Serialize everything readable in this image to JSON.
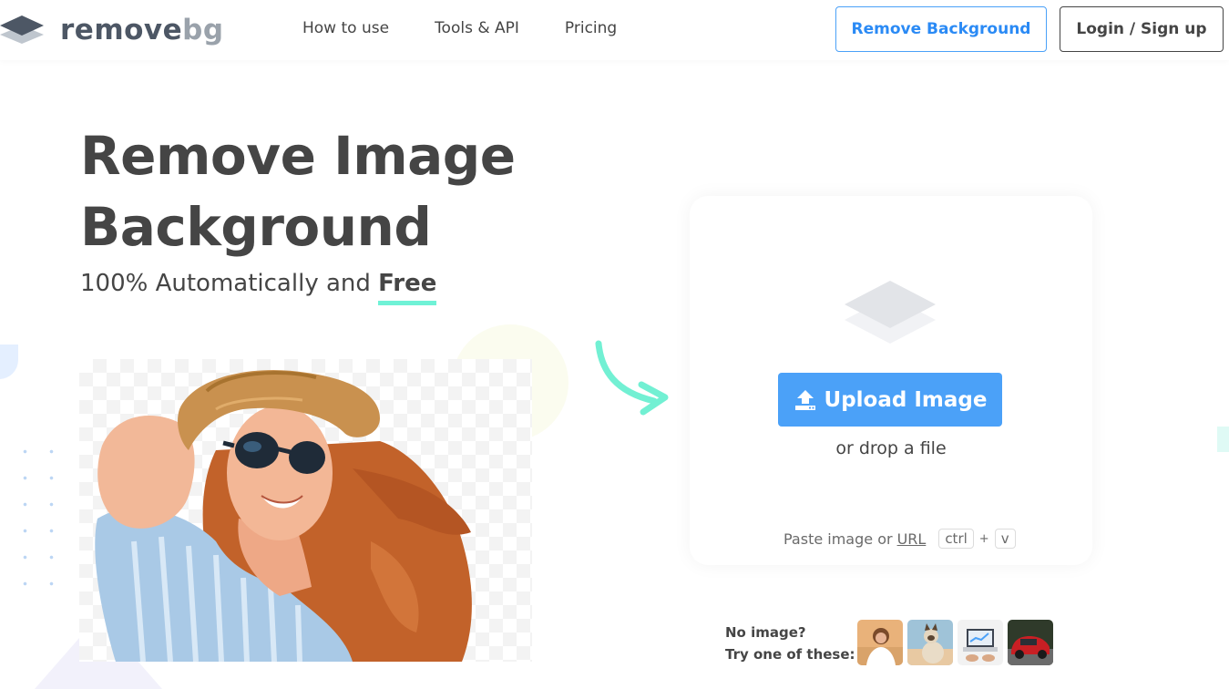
{
  "header": {
    "logo": {
      "word1": "remove",
      "word2": "bg"
    },
    "nav": [
      "How to use",
      "Tools & API",
      "Pricing"
    ],
    "remove_background_label": "Remove Background",
    "login_label": "Login / Sign up"
  },
  "hero": {
    "title_line1": "Remove Image",
    "title_line2": "Background",
    "subtitle_prefix": "100% Automatically and",
    "subtitle_highlight": "Free"
  },
  "upload": {
    "button_label": "Upload Image",
    "drop_text": "or drop a file",
    "paste_prefix": "Paste image or",
    "paste_url": "URL",
    "kbd_ctrl": "ctrl",
    "kbd_plus": "+",
    "kbd_v": "v"
  },
  "samples": {
    "line1": "No image?",
    "line2": "Try one of these:"
  },
  "colors": {
    "accent_blue": "#4ba1f8",
    "text_dark": "#454545",
    "mint_highlight": "#6ff2d6"
  }
}
